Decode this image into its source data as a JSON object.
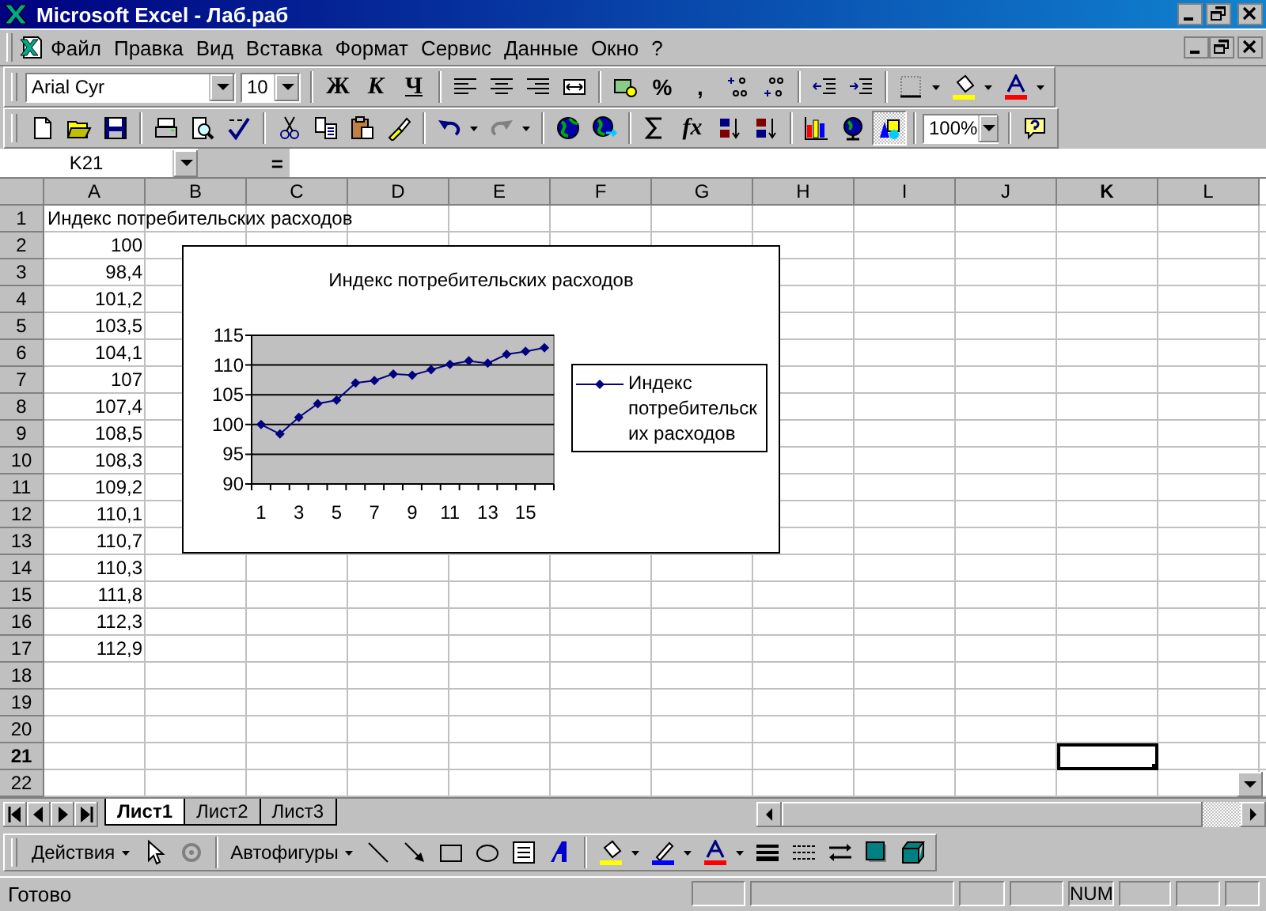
{
  "window": {
    "title": "Microsoft Excel - Лаб.раб"
  },
  "menu_bar": {
    "items": [
      {
        "label": "Файл"
      },
      {
        "label": "Правка"
      },
      {
        "label": "Вид"
      },
      {
        "label": "Вставка"
      },
      {
        "label": "Формат"
      },
      {
        "label": "Сервис"
      },
      {
        "label": "Данные"
      },
      {
        "label": "Окно"
      },
      {
        "label": "?"
      }
    ]
  },
  "formatting_toolbar": {
    "font": {
      "value": "Arial Cyr"
    },
    "size": {
      "value": "10"
    },
    "text_buttons": [
      {
        "label": "Ж",
        "kind": "bold"
      },
      {
        "label": "К",
        "kind": "italic"
      },
      {
        "label": "Ч",
        "kind": "underline"
      },
      {
        "label": "%",
        "kind": "plain"
      },
      {
        "label": ",",
        "kind": "plain"
      }
    ]
  },
  "standard_toolbar": {
    "text_buttons": [
      {
        "label": "fx",
        "kind": "italic"
      }
    ],
    "zoom": {
      "value": "100%"
    },
    "drawing_button": {
      "pressed": true
    }
  },
  "formula_bar": {
    "name_box": "K21",
    "equals": "="
  },
  "sheet": {
    "columns": [
      {
        "label": "A",
        "selected": false
      },
      {
        "label": "B",
        "selected": false
      },
      {
        "label": "C",
        "selected": false
      },
      {
        "label": "D",
        "selected": false
      },
      {
        "label": "E",
        "selected": false
      },
      {
        "label": "F",
        "selected": false
      },
      {
        "label": "G",
        "selected": false
      },
      {
        "label": "H",
        "selected": false
      },
      {
        "label": "I",
        "selected": false
      },
      {
        "label": "J",
        "selected": false
      },
      {
        "label": "K",
        "selected": true
      },
      {
        "label": "L",
        "selected": false
      }
    ],
    "rows": [
      {
        "label": "1",
        "selected": false,
        "cells": [
          {
            "text": "Индекс потребительских расходов",
            "kind": "text"
          }
        ]
      },
      {
        "label": "2",
        "selected": false,
        "cells": [
          {
            "text": "100",
            "kind": "number"
          }
        ]
      },
      {
        "label": "3",
        "selected": false,
        "cells": [
          {
            "text": "98,4",
            "kind": "number"
          }
        ]
      },
      {
        "label": "4",
        "selected": false,
        "cells": [
          {
            "text": "101,2",
            "kind": "number"
          }
        ]
      },
      {
        "label": "5",
        "selected": false,
        "cells": [
          {
            "text": "103,5",
            "kind": "number"
          }
        ]
      },
      {
        "label": "6",
        "selected": false,
        "cells": [
          {
            "text": "104,1",
            "kind": "number"
          }
        ]
      },
      {
        "label": "7",
        "selected": false,
        "cells": [
          {
            "text": "107",
            "kind": "number"
          }
        ]
      },
      {
        "label": "8",
        "selected": false,
        "cells": [
          {
            "text": "107,4",
            "kind": "number"
          }
        ]
      },
      {
        "label": "9",
        "selected": false,
        "cells": [
          {
            "text": "108,5",
            "kind": "number"
          }
        ]
      },
      {
        "label": "10",
        "selected": false,
        "cells": [
          {
            "text": "108,3",
            "kind": "number"
          }
        ]
      },
      {
        "label": "11",
        "selected": false,
        "cells": [
          {
            "text": "109,2",
            "kind": "number"
          }
        ]
      },
      {
        "label": "12",
        "selected": false,
        "cells": [
          {
            "text": "110,1",
            "kind": "number"
          }
        ]
      },
      {
        "label": "13",
        "selected": false,
        "cells": [
          {
            "text": "110,7",
            "kind": "number"
          }
        ]
      },
      {
        "label": "14",
        "selected": false,
        "cells": [
          {
            "text": "110,3",
            "kind": "number"
          }
        ]
      },
      {
        "label": "15",
        "selected": false,
        "cells": [
          {
            "text": "111,8",
            "kind": "number"
          }
        ]
      },
      {
        "label": "16",
        "selected": false,
        "cells": [
          {
            "text": "112,3",
            "kind": "number"
          }
        ]
      },
      {
        "label": "17",
        "selected": false,
        "cells": [
          {
            "text": "112,9",
            "kind": "number"
          }
        ]
      },
      {
        "label": "18",
        "selected": false
      },
      {
        "label": "19",
        "selected": false
      },
      {
        "label": "20",
        "selected": false
      },
      {
        "label": "21",
        "selected": true
      },
      {
        "label": "22",
        "selected": false
      }
    ],
    "chart": {
      "chart_data": {
        "type": "line",
        "title": "Индекс потребительских расходов",
        "x": [
          1,
          2,
          3,
          4,
          5,
          6,
          7,
          8,
          9,
          10,
          11,
          12,
          13,
          14,
          15,
          16
        ],
        "grid": true,
        "series": [
          {
            "name": "Индекс потребительских расходов",
            "color": "#000080",
            "marker": "diamond",
            "values": [
              100,
              98.4,
              101.2,
              103.5,
              104.1,
              107,
              107.4,
              108.5,
              108.3,
              109.2,
              110.1,
              110.7,
              110.3,
              111.8,
              112.3,
              112.9
            ]
          }
        ],
        "xlim": [
          0.5,
          16.5
        ],
        "ylim": [
          90,
          115
        ],
        "yticks": [
          90,
          95,
          100,
          105,
          110,
          115
        ],
        "xticks": [
          1,
          3,
          5,
          7,
          9,
          11,
          13,
          15
        ]
      }
    }
  },
  "sheet_tabs": [
    {
      "label": "Лист1",
      "selected": true
    },
    {
      "label": "Лист2",
      "selected": false
    },
    {
      "label": "Лист3",
      "selected": false
    }
  ],
  "drawing_toolbar": {
    "menus": [
      {
        "label": "Действия"
      },
      {
        "label": "Автофигуры"
      }
    ]
  },
  "status_bar": {
    "message": "Готово",
    "num_indicator": "NUM"
  }
}
